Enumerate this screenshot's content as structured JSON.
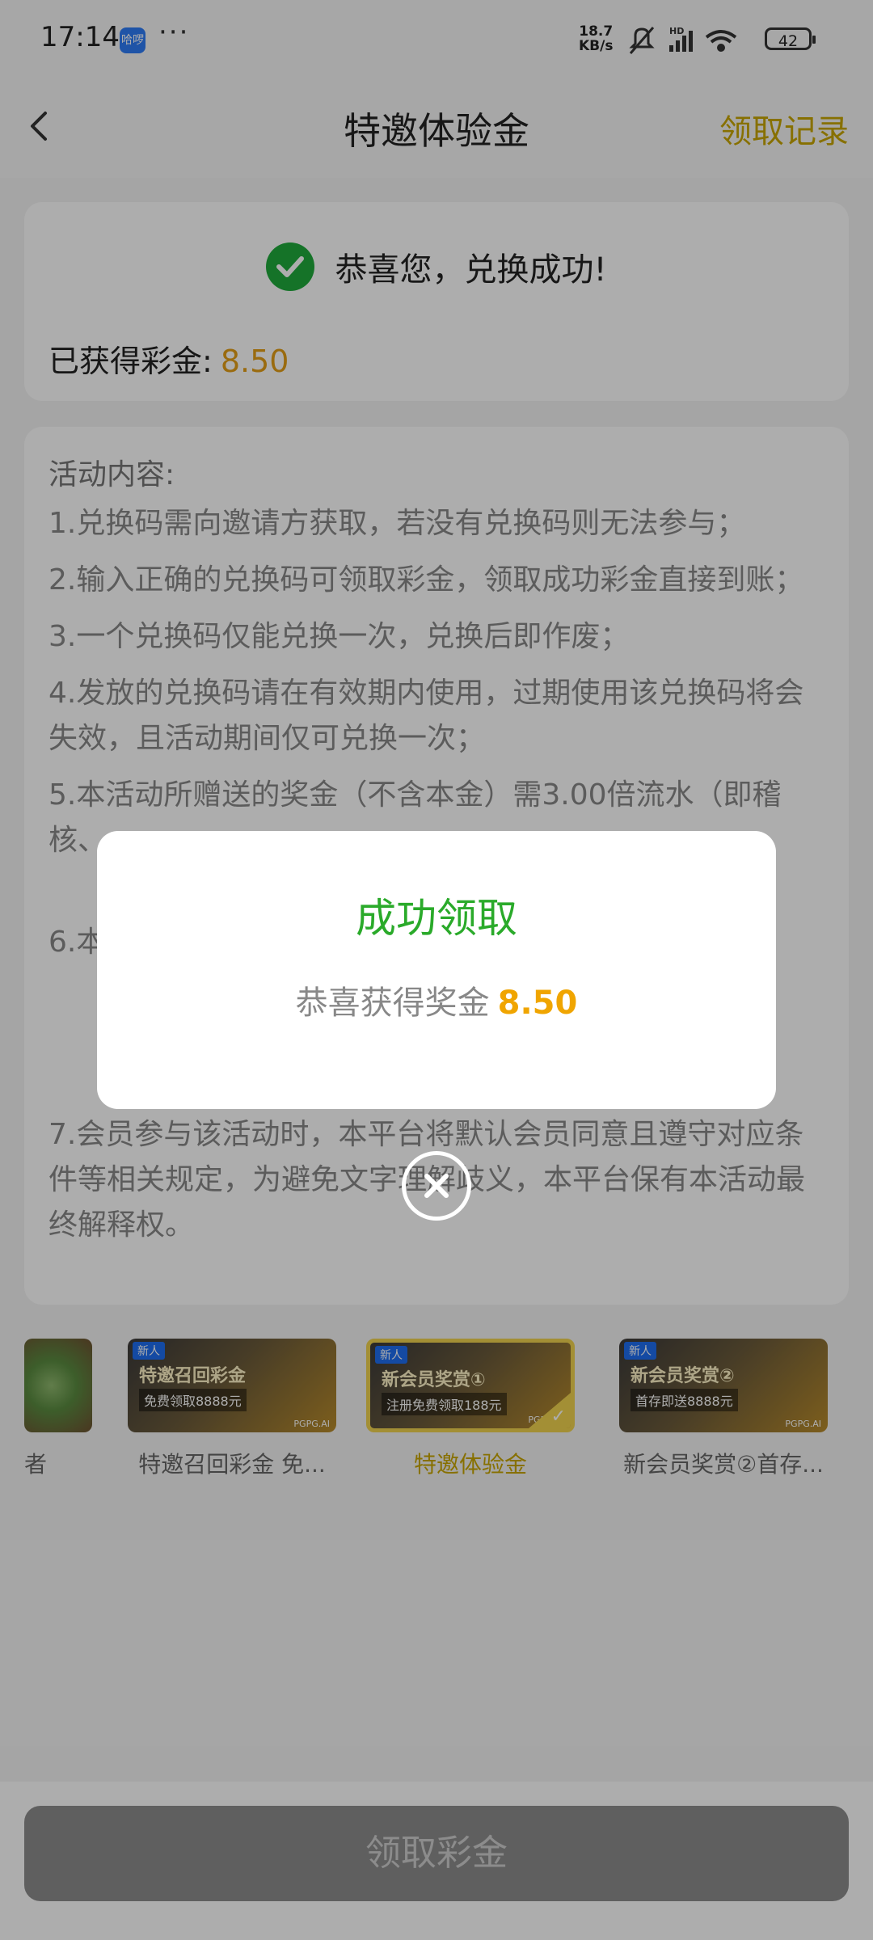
{
  "status_bar": {
    "time": "17:14",
    "app_badge": "哈啰",
    "more": "···",
    "speed_value": "18.7",
    "speed_unit": "KB/s",
    "battery": "42"
  },
  "nav": {
    "title": "特邀体验金",
    "record_label": "领取记录"
  },
  "success_card": {
    "message": "恭喜您，兑换成功!",
    "bonus_label": "已获得彩金:",
    "bonus_value": "8.50"
  },
  "rules": {
    "title": "活动内容:",
    "items": [
      "1.兑换码需向邀请方获取，若没有兑换码则无法参与；",
      "2.输入正确的兑换码可领取彩金，领取成功彩金直接到账；",
      "3.一个兑换码仅能兑换一次，兑换后即作废；",
      "4.发放的兑换码请在有效期内使用，过期使用该兑换码将会失效，且活动期间仅可兑换一次；",
      "5.本活动所赠送的奖金（不含本金）需3.00倍流水（即稽核、",
      "6.本",
      "7.会员参与该活动时，本平台将默认会员同意且遵守对应条件等相关规定，为避免文字理解歧义，本平台保有本活动最终解释权。"
    ]
  },
  "promos": [
    {
      "title": "",
      "label": "者",
      "partial": true
    },
    {
      "new_tag": "新人",
      "title": "特邀召回彩金",
      "subtitle": "免费领取8888元",
      "brand": "PGPG.AI",
      "label": "特邀召回彩金 免..."
    },
    {
      "new_tag": "新人",
      "title": "新会员奖赏①",
      "subtitle": "注册免费领取188元",
      "brand": "PGPG.AI",
      "label": "特邀体验金",
      "selected": true
    },
    {
      "new_tag": "新人",
      "title": "新会员奖赏②",
      "subtitle": "首存即送8888元",
      "brand": "PGPG.AI",
      "label": "新会员奖赏②首存..."
    }
  ],
  "bottom": {
    "claim_label": "领取彩金"
  },
  "modal": {
    "title": "成功领取",
    "text": "恭喜获得奖金",
    "amount": "8.50"
  },
  "colors": {
    "accent_gold": "#c8a600",
    "amount_orange": "#f0a500",
    "success_green": "#2aaa2a"
  }
}
